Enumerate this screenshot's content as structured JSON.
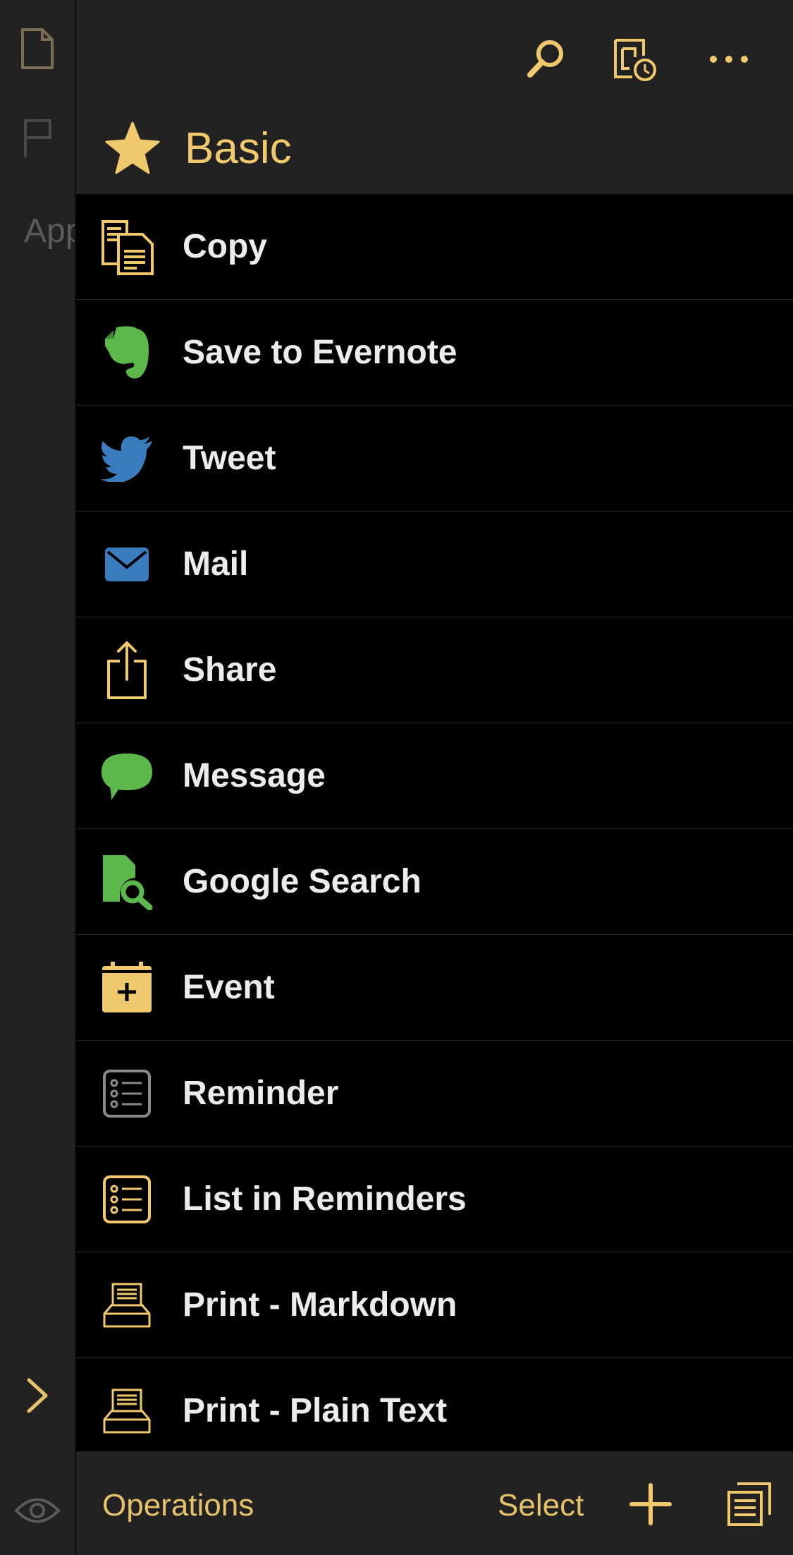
{
  "background": {
    "partial_text": "App"
  },
  "header": {
    "title": "Basic",
    "icons": [
      "search-icon",
      "history-icon",
      "more-icon",
      "star-icon"
    ]
  },
  "actions": [
    {
      "label": "Copy",
      "icon": "copy-icon",
      "color": "#f0c96c"
    },
    {
      "label": "Save to Evernote",
      "icon": "evernote-icon",
      "color": "#5cb84a"
    },
    {
      "label": "Tweet",
      "icon": "twitter-icon",
      "color": "#3a7dbf"
    },
    {
      "label": "Mail",
      "icon": "mail-icon",
      "color": "#3a7dbf"
    },
    {
      "label": "Share",
      "icon": "share-icon",
      "color": "#f0c96c"
    },
    {
      "label": "Message",
      "icon": "message-icon",
      "color": "#5cb84a"
    },
    {
      "label": "Google Search",
      "icon": "google-search-icon",
      "color": "#5cb84a"
    },
    {
      "label": "Event",
      "icon": "calendar-add-icon",
      "color": "#f0c96c"
    },
    {
      "label": "Reminder",
      "icon": "checklist-icon",
      "color": "#8a8a8a"
    },
    {
      "label": "List in Reminders",
      "icon": "checklist-icon",
      "color": "#f0c96c"
    },
    {
      "label": "Print - Markdown",
      "icon": "printer-icon",
      "color": "#f0c96c"
    },
    {
      "label": "Print - Plain Text",
      "icon": "printer-icon",
      "color": "#f0c96c"
    }
  ],
  "bottombar": {
    "operations": "Operations",
    "select": "Select"
  },
  "colors": {
    "accent": "#f0c96c",
    "panel_bg": "#000000",
    "bar_bg": "#222222"
  }
}
